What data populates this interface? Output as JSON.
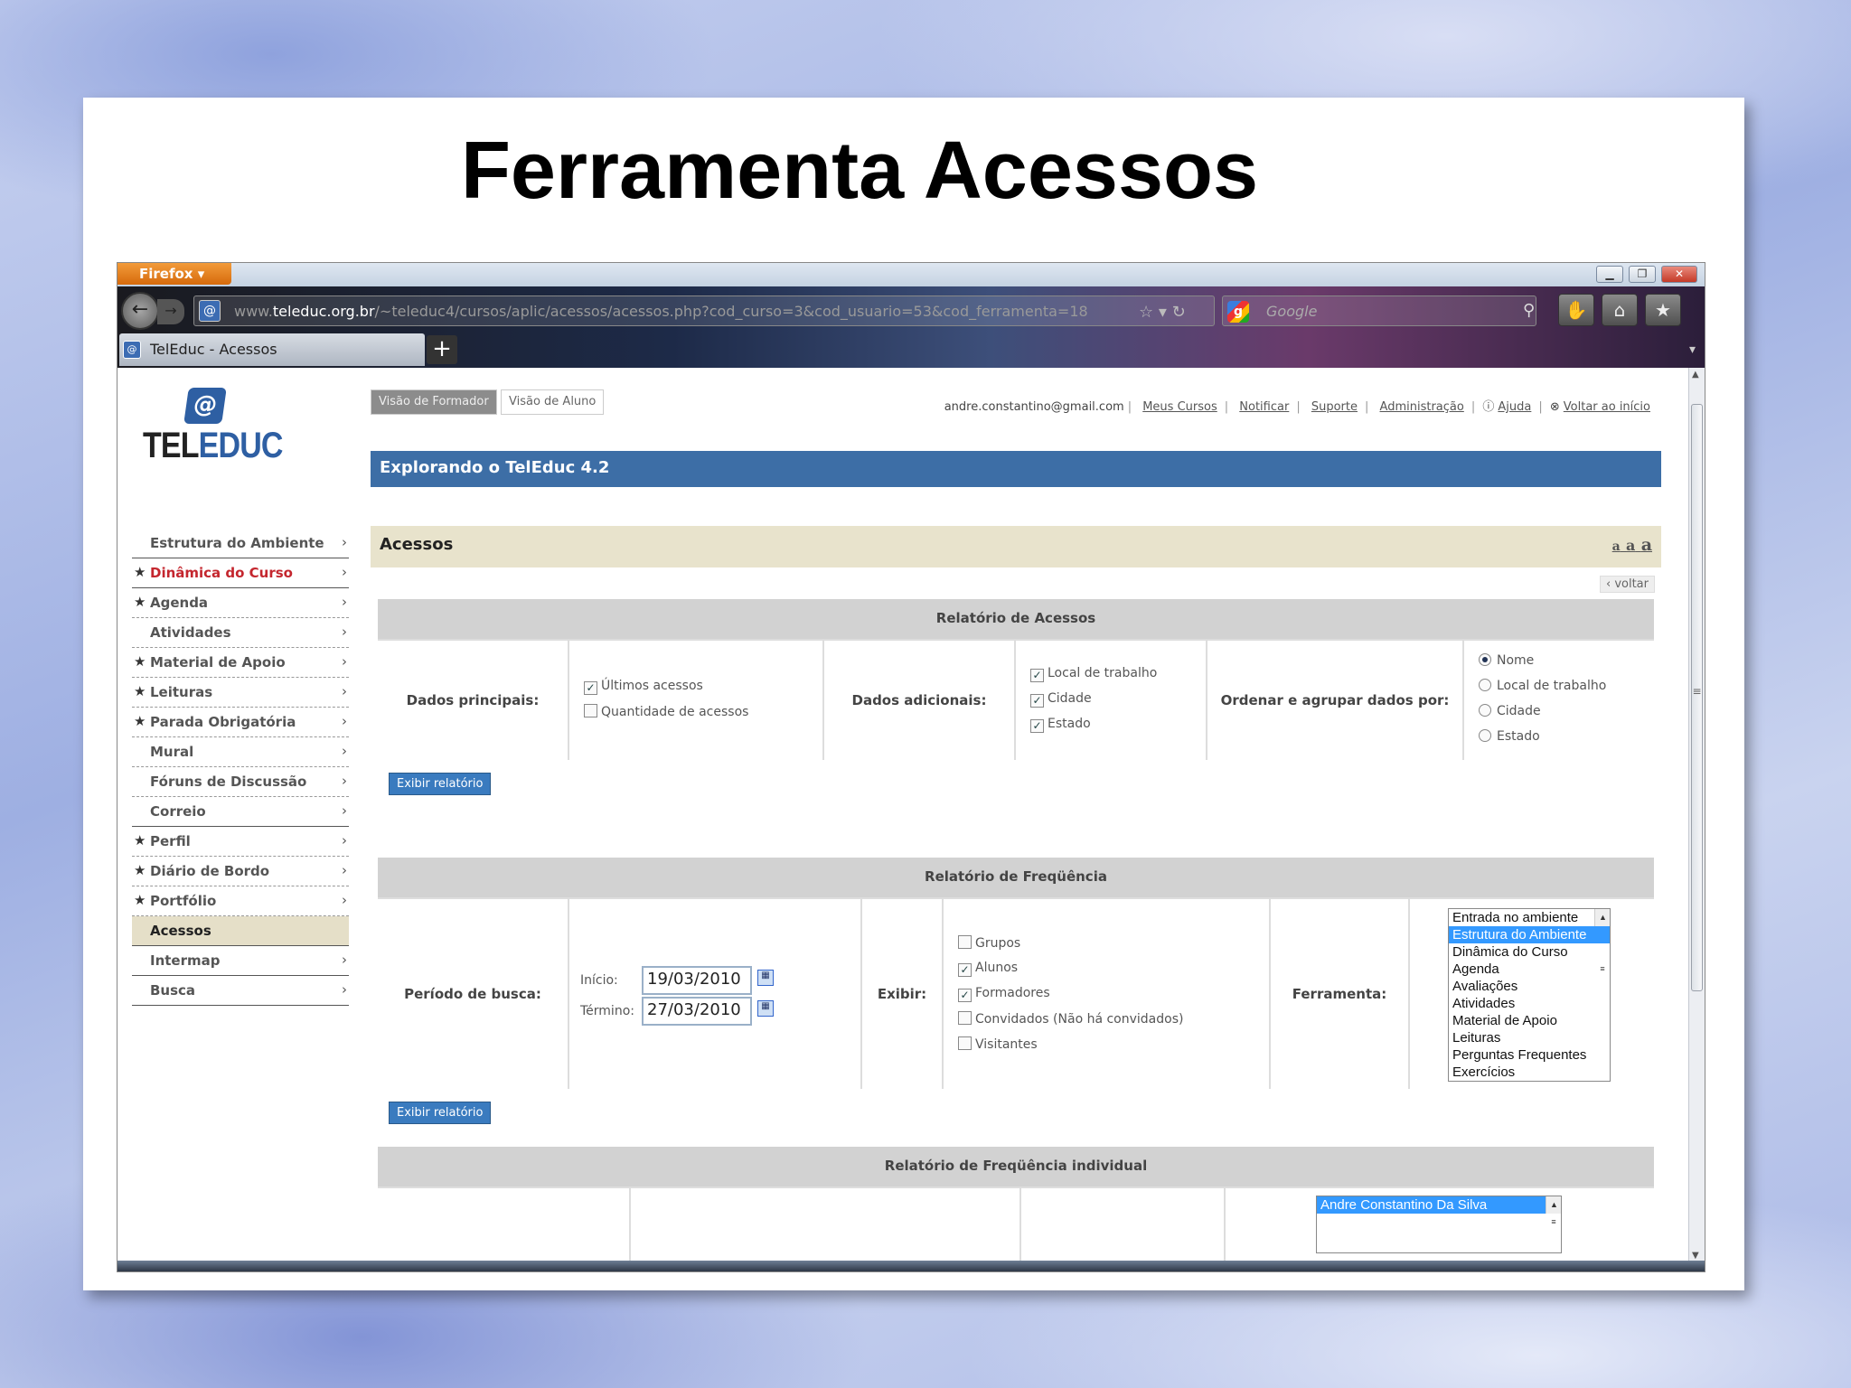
{
  "slide": {
    "title": "Ferramenta Acessos"
  },
  "browser": {
    "menu_button": "Firefox",
    "url_prefix": "www.",
    "url_domain": "teleduc.org.br",
    "url_path": "/~teleduc4/cursos/aplic/acessos/acessos.php?cod_curso=3&cod_usuario=53&cod_ferramenta=18",
    "search_placeholder": "Google",
    "tab_title": "TelEduc - Acessos",
    "new_tab": "+"
  },
  "logo": {
    "at": "@",
    "part1": "TEL",
    "part2": "EDUC"
  },
  "view_buttons": {
    "formador": "Visão de Formador",
    "aluno": "Visão de Aluno"
  },
  "top_links": {
    "email": "andre.constantino@gmail.com",
    "meus_cursos": "Meus Cursos",
    "notificar": "Notificar",
    "suporte": "Suporte",
    "administracao": "Administração",
    "ajuda": "Ajuda",
    "voltar_inicio": "Voltar ao início"
  },
  "banner": "Explorando o TelEduc 4.2",
  "section": {
    "title": "Acessos",
    "font_sizes": [
      "a",
      "a",
      "a"
    ],
    "voltar": "‹ voltar"
  },
  "menu": [
    {
      "label": "Estrutura do Ambiente",
      "star": false
    },
    {
      "label": "Dinâmica do Curso",
      "star": true
    },
    {
      "label": "Agenda",
      "star": true
    },
    {
      "label": "Atividades",
      "star": false
    },
    {
      "label": "Material de Apoio",
      "star": true
    },
    {
      "label": "Leituras",
      "star": true
    },
    {
      "label": "Parada Obrigatória",
      "star": true
    },
    {
      "label": "Mural",
      "star": false
    },
    {
      "label": "Fóruns de Discussão",
      "star": false
    },
    {
      "label": "Correio",
      "star": false
    },
    {
      "label": "Perfil",
      "star": true
    },
    {
      "label": "Diário de Bordo",
      "star": true
    },
    {
      "label": "Portfólio",
      "star": true
    },
    {
      "label": "Acessos",
      "star": false
    },
    {
      "label": "Intermap",
      "star": false
    },
    {
      "label": "Busca",
      "star": false
    }
  ],
  "relatorio_acessos": {
    "title": "Relatório de Acessos",
    "dados_principais_label": "Dados principais:",
    "dados_principais": [
      {
        "label": "Últimos acessos",
        "checked": true
      },
      {
        "label": "Quantidade de acessos",
        "checked": false
      }
    ],
    "dados_adicionais_label": "Dados adicionais:",
    "dados_adicionais": [
      {
        "label": "Local de trabalho",
        "checked": true
      },
      {
        "label": "Cidade",
        "checked": true
      },
      {
        "label": "Estado",
        "checked": true
      }
    ],
    "ordenar_label": "Ordenar e agrupar dados por:",
    "ordenar": [
      {
        "label": "Nome",
        "selected": true
      },
      {
        "label": "Local de trabalho",
        "selected": false
      },
      {
        "label": "Cidade",
        "selected": false
      },
      {
        "label": "Estado",
        "selected": false
      }
    ],
    "button": "Exibir relatório"
  },
  "relatorio_frequencia": {
    "title": "Relatório de Freqüência",
    "periodo_label": "Período de busca:",
    "inicio_label": "Início:",
    "inicio": "19/03/2010",
    "termino_label": "Término:",
    "termino": "27/03/2010",
    "exibir_label": "Exibir:",
    "exibir": [
      {
        "label": "Grupos",
        "checked": false
      },
      {
        "label": "Alunos",
        "checked": true
      },
      {
        "label": "Formadores",
        "checked": true
      },
      {
        "label": "Convidados (Não há convidados)",
        "checked": false
      },
      {
        "label": "Visitantes",
        "checked": false
      }
    ],
    "ferramenta_label": "Ferramenta:",
    "ferramentas": [
      "Entrada no ambiente",
      "Estrutura do Ambiente",
      "Dinâmica do Curso",
      "Agenda",
      "Avaliações",
      "Atividades",
      "Material de Apoio",
      "Leituras",
      "Perguntas Frequentes",
      "Exercícios"
    ],
    "ferramenta_selected": "Estrutura do Ambiente",
    "button": "Exibir relatório"
  },
  "relatorio_individual": {
    "title": "Relatório de Freqüência individual",
    "users": [
      "Andre Constantino Da Silva"
    ]
  },
  "colors": {
    "banner": "#3d6ea6",
    "section_bar": "#e8e3cc",
    "button": "#3a7bbf",
    "menu_active": "#c4262e"
  }
}
